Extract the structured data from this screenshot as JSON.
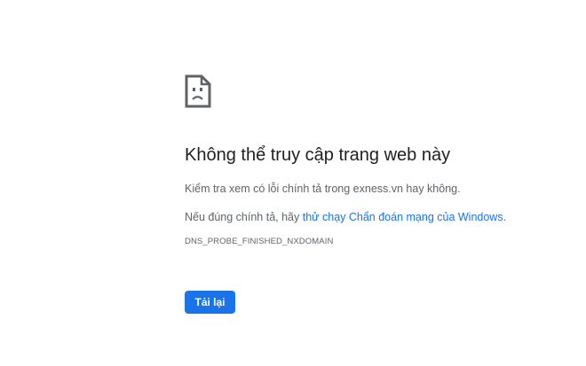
{
  "icon": "sad-page-icon",
  "heading": "Không thể truy cập trang web này",
  "check_line": "Kiểm tra xem có lỗi chính tả trong exness.vn hay không.",
  "suggestion": {
    "prefix": "Nếu đúng chính tả, hãy ",
    "link_text": "thử chạy Chẩn đoán mạng của Windows",
    "suffix": "."
  },
  "error_code": "DNS_PROBE_FINISHED_NXDOMAIN",
  "reload_label": "Tải lại",
  "colors": {
    "accent": "#1a73e8",
    "heading": "#202124",
    "body_text": "#5f6368"
  }
}
